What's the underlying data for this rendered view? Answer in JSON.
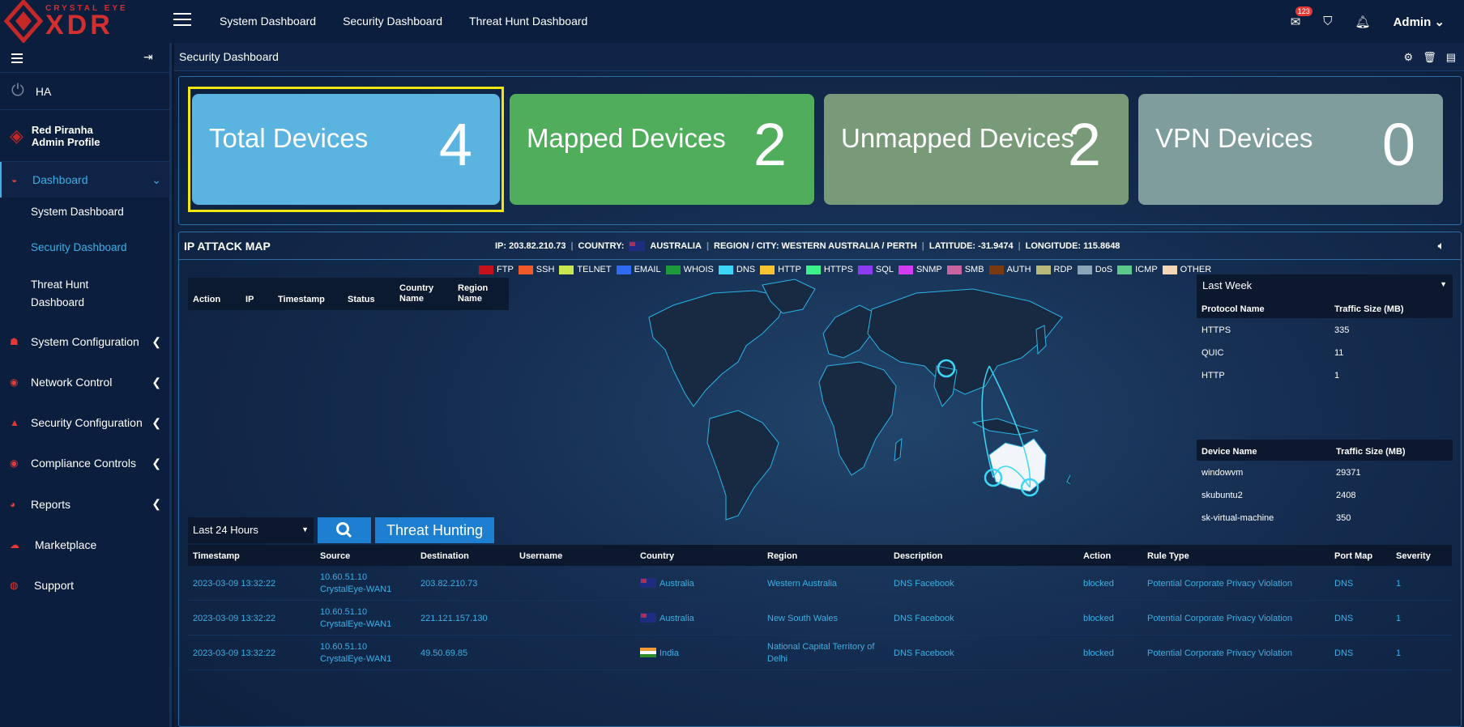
{
  "brand": {
    "small": "CRYSTAL EYE",
    "big": "XDR"
  },
  "topnav": [
    "System Dashboard",
    "Security Dashboard",
    "Threat Hunt Dashboard"
  ],
  "topbar": {
    "mail_badge": "123",
    "user": "Admin"
  },
  "sidebar": {
    "ha": "HA",
    "profile_name": "Red Piranha",
    "profile_role": "Admin Profile",
    "dashboard": "Dashboard",
    "subs": [
      "System Dashboard",
      "Security Dashboard",
      "Threat Hunt Dashboard"
    ],
    "items": [
      "System Configuration",
      "Network Control",
      "Security Configuration",
      "Compliance Controls",
      "Reports",
      "Marketplace",
      "Support"
    ]
  },
  "breadcrumb": "Security Dashboard",
  "cards": [
    {
      "label": "Total Devices",
      "value": "4",
      "color": "#5bb4df"
    },
    {
      "label": "Mapped Devices",
      "value": "2",
      "color": "#4fad5b"
    },
    {
      "label": "Unmapped Devices",
      "value": "2",
      "color": "#799a78"
    },
    {
      "label": "VPN Devices",
      "value": "0",
      "color": "#7f9d9d"
    }
  ],
  "map": {
    "title": "IP ATTACK MAP",
    "ip": "IP: 203.82.210.73",
    "country_label": "COUNTRY:",
    "country": "AUSTRALIA",
    "region": "REGION / CITY: WESTERN AUSTRALIA / PERTH",
    "lat": "LATITUDE: -31.9474",
    "lon": "LONGITUDE: 115.8648"
  },
  "legend": [
    {
      "name": "FTP",
      "color": "#c2121c"
    },
    {
      "name": "SSH",
      "color": "#f05a28"
    },
    {
      "name": "TELNET",
      "color": "#c8e650"
    },
    {
      "name": "EMAIL",
      "color": "#2f6bf0"
    },
    {
      "name": "WHOIS",
      "color": "#1f9a3a"
    },
    {
      "name": "DNS",
      "color": "#3dd6f5"
    },
    {
      "name": "HTTP",
      "color": "#f5c430"
    },
    {
      "name": "HTTPS",
      "color": "#3cf08a"
    },
    {
      "name": "SQL",
      "color": "#8c3cf0"
    },
    {
      "name": "SNMP",
      "color": "#d23cf0"
    },
    {
      "name": "SMB",
      "color": "#c864a0"
    },
    {
      "name": "AUTH",
      "color": "#7a3a10"
    },
    {
      "name": "RDP",
      "color": "#b8b87a"
    },
    {
      "name": "DoS",
      "color": "#8aa4b8"
    },
    {
      "name": "ICMP",
      "color": "#5cc88a"
    },
    {
      "name": "OTHER",
      "color": "#f5d6b4"
    }
  ],
  "attack_table_headers": [
    "Action",
    "IP",
    "Timestamp",
    "Status",
    "Country Name",
    "Region Name"
  ],
  "traffic": {
    "period": "Last Week",
    "protocol_headers": [
      "Protocol Name",
      "Traffic Size (MB)"
    ],
    "protocols": [
      [
        "HTTPS",
        "335"
      ],
      [
        "QUIC",
        "11"
      ],
      [
        "HTTP",
        "1"
      ]
    ],
    "device_headers": [
      "Device Name",
      "Traffic Size (MB)"
    ],
    "devices": [
      [
        "windowvm",
        "29371"
      ],
      [
        "skubuntu2",
        "2408"
      ],
      [
        "sk-virtual-machine",
        "350"
      ]
    ]
  },
  "controls": {
    "period": "Last 24 Hours",
    "threat_hunting": "Threat Hunting"
  },
  "events": {
    "headers": [
      "Timestamp",
      "Source",
      "Destination",
      "Username",
      "Country",
      "Region",
      "Description",
      "Action",
      "Rule Type",
      "Port Map",
      "Severity"
    ],
    "rows": [
      {
        "ts": "2023-03-09 13:32:22",
        "src1": "10.60.51.10",
        "src2": "CrystalEye-WAN1",
        "dst": "203.82.210.73",
        "country": "Australia",
        "region1": "Western Australia",
        "region2": "",
        "desc": "DNS Facebook",
        "action": "blocked",
        "rule": "Potential Corporate Privacy Violation",
        "port": "DNS",
        "sev": "1"
      },
      {
        "ts": "2023-03-09 13:32:22",
        "src1": "10.60.51.10",
        "src2": "CrystalEye-WAN1",
        "dst": "221.121.157.130",
        "country": "Australia",
        "region1": "New South Wales",
        "region2": "",
        "desc": "DNS Facebook",
        "action": "blocked",
        "rule": "Potential Corporate Privacy Violation",
        "port": "DNS",
        "sev": "1"
      },
      {
        "ts": "2023-03-09 13:32:22",
        "src1": "10.60.51.10",
        "src2": "CrystalEye-WAN1",
        "dst": "49.50.69.85",
        "country": "India",
        "region1": "National Capital Territory of",
        "region2": "Delhi",
        "desc": "DNS Facebook",
        "action": "blocked",
        "rule": "Potential Corporate Privacy Violation",
        "port": "DNS",
        "sev": "1"
      }
    ]
  }
}
